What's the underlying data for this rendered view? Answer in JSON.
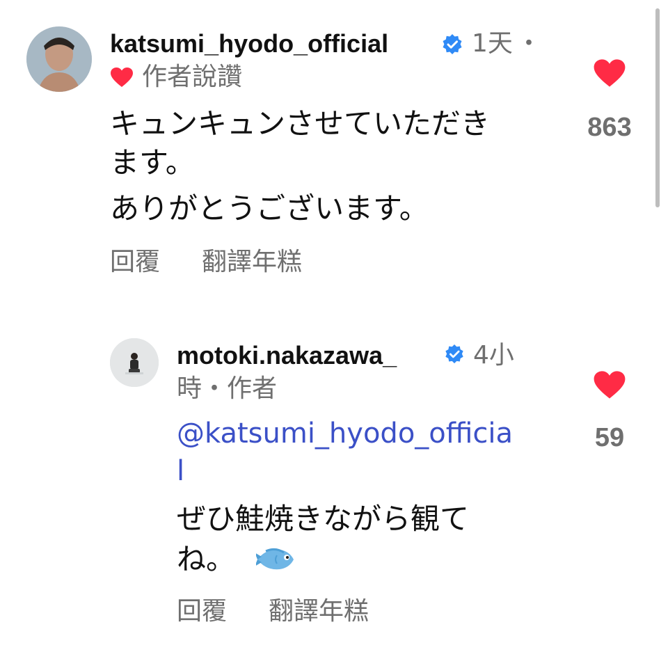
{
  "comments": [
    {
      "username": "katsumi_hyodo_official",
      "time": "1天",
      "dot": "・",
      "author_liked": "作者說讚",
      "text_line1": "キュンキュンさせていただき",
      "text_line2": "ます。",
      "text_line3": "ありがとうございます。",
      "reply_label": "回覆",
      "translate_label": "翻譯年糕",
      "like_count": "863"
    },
    {
      "username": "motoki.nakazawa_",
      "time_part1": "4小",
      "time_part2": "時・作者",
      "mention_line1": "@katsumi_hyodo_officia",
      "mention_line2": "l",
      "text_line1": "ぜひ鮭焼きながら観て",
      "text_line2": "ね。",
      "emoji": "🐟",
      "reply_label": "回覆",
      "translate_label": "翻譯年糕",
      "like_count": "59"
    }
  ],
  "colors": {
    "like_red": "#ff2b45",
    "verified_blue": "#2f8af6",
    "mention_blue": "#3b50c7",
    "meta_gray": "#6f6f6f"
  },
  "icons": {
    "like": "heart-icon",
    "verified": "verified-badge-icon",
    "author_like": "heart-icon"
  }
}
